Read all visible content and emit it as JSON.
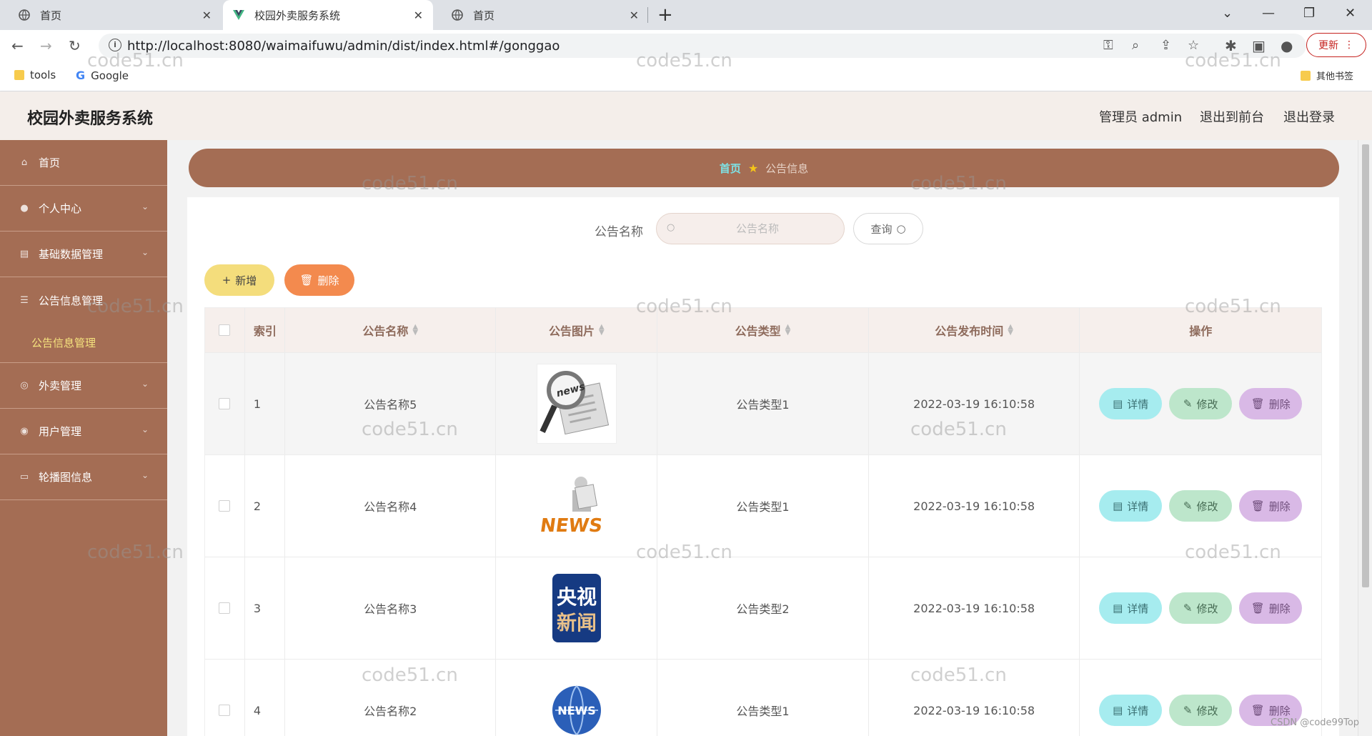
{
  "browser": {
    "tabs": [
      {
        "label": "首页",
        "active": false
      },
      {
        "label": "校园外卖服务系统",
        "active": true
      },
      {
        "label": "首页",
        "active": false
      }
    ],
    "url": "http://localhost:8080/waimaifuwu/admin/dist/index.html#/gonggao",
    "update_label": "更新",
    "bookmarks": [
      {
        "label": "tools",
        "icon": "folder-icon"
      },
      {
        "label": "Google",
        "icon": "google-icon"
      }
    ],
    "other_bookmarks": "其他书签"
  },
  "header": {
    "title": "校园外卖服务系统",
    "user": "管理员 admin",
    "back_front": "退出到前台",
    "logout": "退出登录"
  },
  "sidebar": {
    "items": [
      {
        "label": "首页",
        "icon": "home-icon",
        "has_children": false
      },
      {
        "label": "个人中心",
        "icon": "user-icon",
        "has_children": true
      },
      {
        "label": "基础数据管理",
        "icon": "clipboard-icon",
        "has_children": true
      },
      {
        "label": "公告信息管理",
        "icon": "list-icon",
        "has_children": false
      },
      {
        "label": "外卖管理",
        "icon": "compass-icon",
        "has_children": true
      },
      {
        "label": "用户管理",
        "icon": "target-icon",
        "has_children": true
      },
      {
        "label": "轮播图信息",
        "icon": "message-icon",
        "has_children": true
      }
    ],
    "active_sub": "公告信息管理"
  },
  "breadcrumb": {
    "home": "首页",
    "current": "公告信息"
  },
  "search": {
    "label": "公告名称",
    "placeholder": "公告名称",
    "button": "查询"
  },
  "actions": {
    "add": "新增",
    "delete": "删除"
  },
  "table": {
    "columns": [
      "索引",
      "公告名称",
      "公告图片",
      "公告类型",
      "公告发布时间",
      "操作"
    ],
    "rows": [
      {
        "index": "1",
        "name": "公告名称5",
        "image": "magnifier-news-image",
        "type": "公告类型1",
        "time": "2022-03-19 16:10:58"
      },
      {
        "index": "2",
        "name": "公告名称4",
        "image": "news-reader-image",
        "type": "公告类型1",
        "time": "2022-03-19 16:10:58"
      },
      {
        "index": "3",
        "name": "公告名称3",
        "image": "cctv-news-image",
        "type": "公告类型2",
        "time": "2022-03-19 16:10:58"
      },
      {
        "index": "4",
        "name": "公告名称2",
        "image": "globe-news-image",
        "type": "公告类型1",
        "time": "2022-03-19 16:10:58"
      }
    ],
    "row_actions": {
      "detail": "详情",
      "edit": "修改",
      "remove": "删除"
    },
    "image_texts": {
      "news": "news",
      "news_caps": "NEWS",
      "cctv_line1": "央视",
      "cctv_line2": "新闻"
    }
  },
  "watermark": "code51.cn",
  "csdn": "CSDN @code99Top"
}
